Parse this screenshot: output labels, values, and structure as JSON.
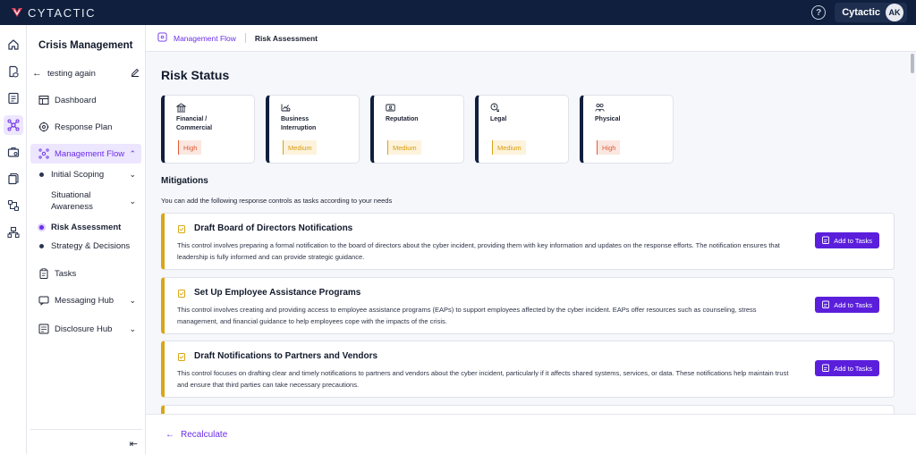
{
  "app": {
    "brand": "CYTACTIC"
  },
  "topbar": {
    "help_icon": "help-circle-icon",
    "account_name": "Cytactic",
    "avatar_initials": "AK"
  },
  "rail": {
    "icons": [
      "home-icon",
      "document-shield-icon",
      "list-check-icon",
      "hub-network-icon",
      "briefcase-gear-icon",
      "files-icon",
      "flow-icon",
      "org-chart-icon"
    ],
    "active_index": 3
  },
  "sidebar": {
    "title": "Crisis Management",
    "back_label": "testing again",
    "items": {
      "dashboard": "Dashboard",
      "response_plan": "Response Plan",
      "management_flow": "Management Flow",
      "initial_scoping": "Initial Scoping",
      "situational_awareness": "Situational Awareness",
      "risk_assessment": "Risk Assessment",
      "strategy_decisions": "Strategy & Decisions",
      "tasks": "Tasks",
      "messaging_hub": "Messaging Hub",
      "disclosure_hub": "Disclosure Hub"
    }
  },
  "breadcrumb": {
    "link": "Management Flow",
    "current": "Risk Assessment"
  },
  "main": {
    "title": "Risk Status",
    "risks": [
      {
        "name_line1": "Financial /",
        "name_line2": "Commercial",
        "level": "High",
        "icon": "bank-icon"
      },
      {
        "name_line1": "Business",
        "name_line2": "Interruption",
        "level": "Medium",
        "icon": "chart-break-icon"
      },
      {
        "name_line1": "Reputation",
        "name_line2": "",
        "level": "Medium",
        "icon": "id-card-icon"
      },
      {
        "name_line1": "Legal",
        "name_line2": "",
        "level": "Medium",
        "icon": "gavel-clock-icon"
      },
      {
        "name_line1": "Physical",
        "name_line2": "",
        "level": "High",
        "icon": "people-icon"
      }
    ],
    "mitigations_title": "Mitigations",
    "mitigations_desc": "You can add the following response controls as tasks according to your needs",
    "mitigations": [
      {
        "title": "Draft Board of Directors Notifications",
        "body": "This control involves preparing a formal notification to the board of directors about the cyber incident, providing them with key information and updates on the response efforts. The notification ensures that leadership is fully informed and can provide strategic guidance.",
        "button": "Add to Tasks"
      },
      {
        "title": "Set Up Employee Assistance Programs",
        "body": "This control involves creating and providing access to employee assistance programs (EAPs) to support employees affected by the cyber incident. EAPs offer resources such as counseling, stress management, and financial guidance to help employees cope with the impacts of the crisis.",
        "button": "Add to Tasks"
      },
      {
        "title": "Draft Notifications to Partners and Vendors",
        "body": "This control focuses on drafting clear and timely notifications to partners and vendors about the cyber incident, particularly if it affects shared systems, services, or data. These notifications help maintain trust and ensure that third parties can take necessary precautions.",
        "button": "Add to Tasks"
      }
    ]
  },
  "footer": {
    "recalculate": "Recalculate"
  },
  "colors": {
    "brand_purple": "#6b2ee8",
    "button_purple": "#5b1fdc",
    "navy": "#0f1f3d",
    "high": "#e05a36",
    "medium": "#d99a0a",
    "mitigation_accent": "#d9a615"
  }
}
